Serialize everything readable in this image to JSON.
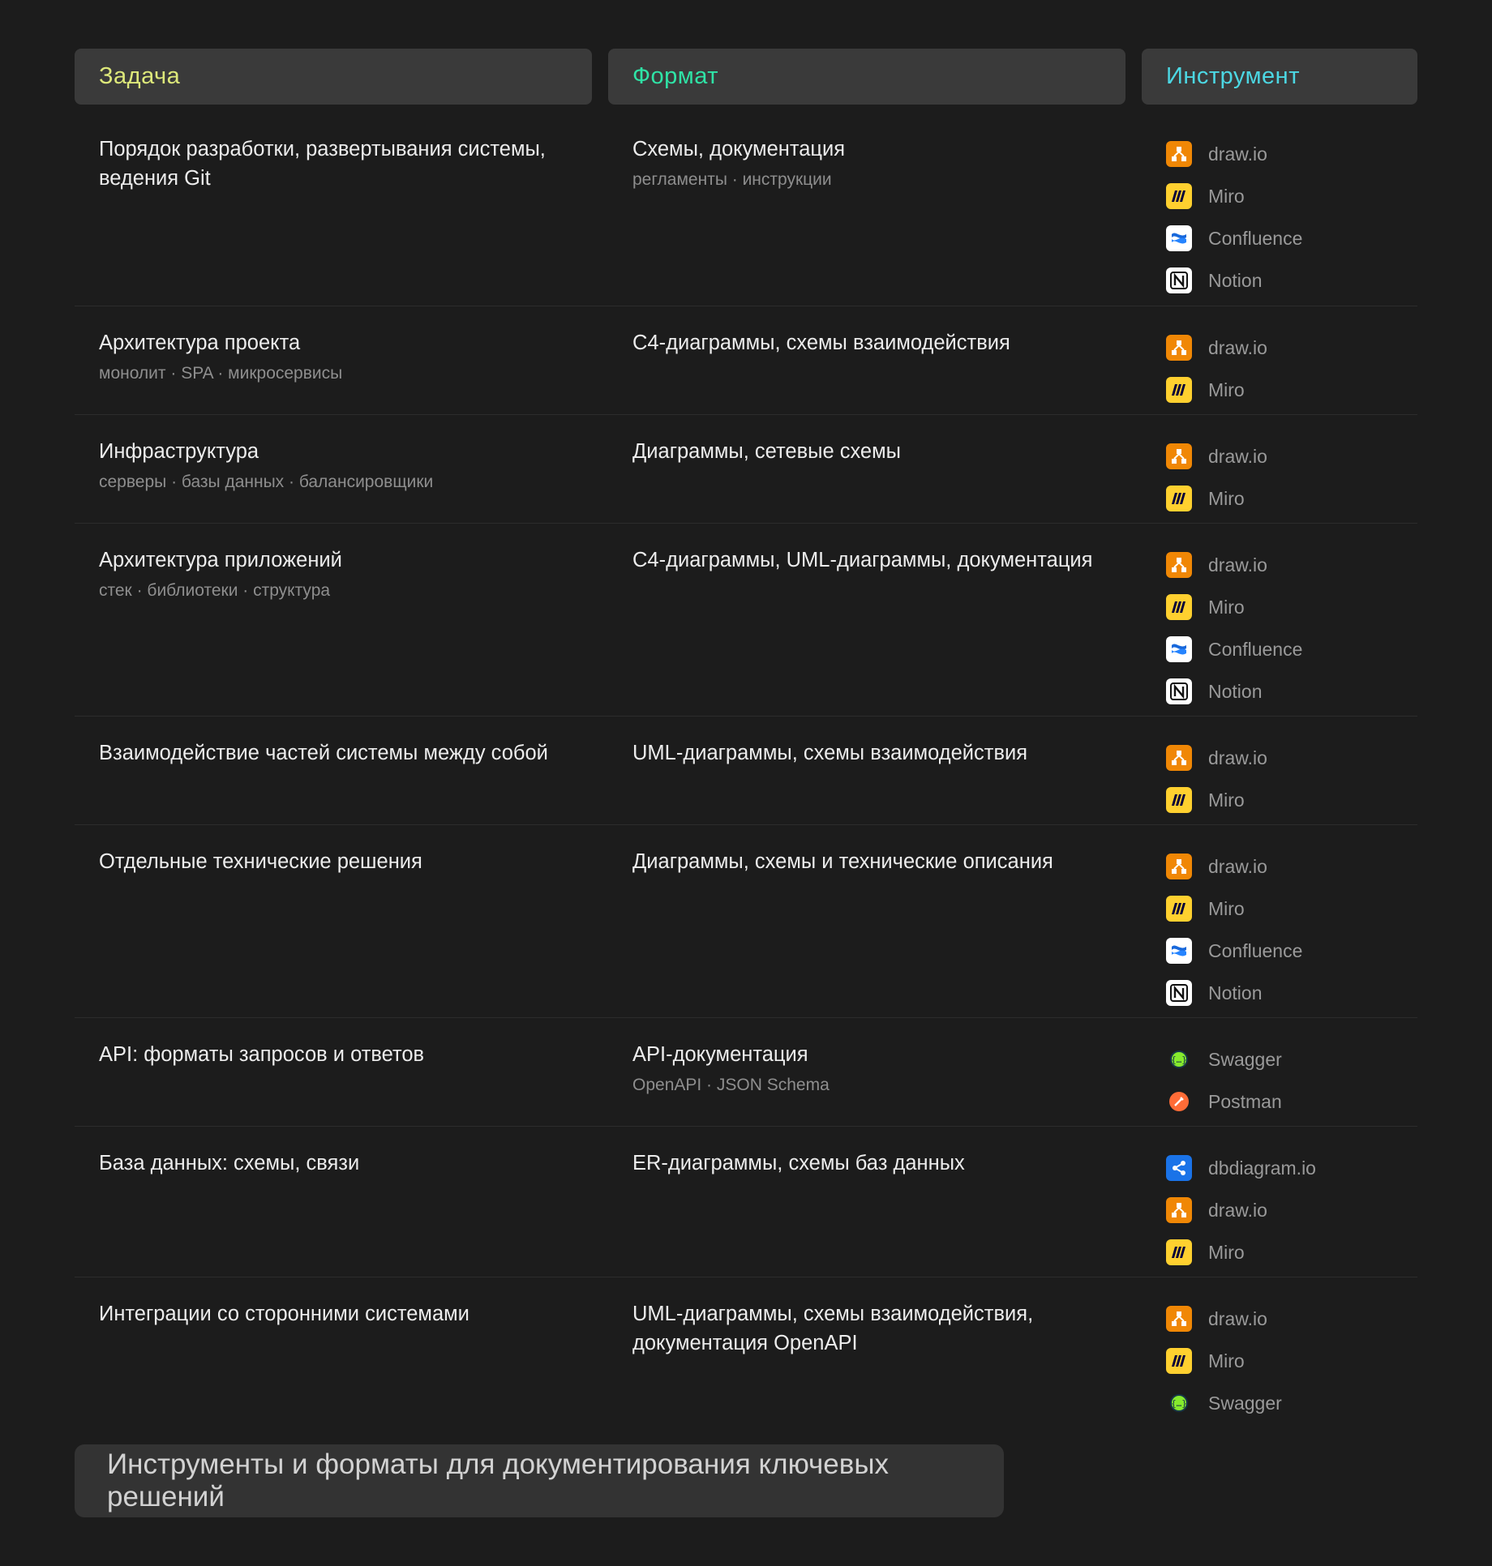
{
  "header": {
    "col_task": "Задача",
    "col_format": "Формат",
    "col_tool": "Инструмент",
    "colors": {
      "task": "#dde87a",
      "format": "#2fe3a6",
      "tool": "#4cd7e3"
    }
  },
  "tool_styles": {
    "drawio": {
      "icon": "drawio-icon",
      "bg": "#f08705"
    },
    "miro": {
      "icon": "miro-icon",
      "bg": "#ffd02f"
    },
    "confluence": {
      "icon": "confluence-icon",
      "bg": "#ffffff"
    },
    "notion": {
      "icon": "notion-icon",
      "bg": "#ffffff"
    },
    "swagger": {
      "icon": "swagger-icon",
      "bg": "#85ea2d"
    },
    "postman": {
      "icon": "postman-icon",
      "bg": "#ff6c37"
    },
    "dbdiagram": {
      "icon": "dbdiagram-icon",
      "bg": "#1a73e8"
    }
  },
  "rows": [
    {
      "task": "Порядок разработки, развертывания системы, ведения Git",
      "task_sub": "",
      "format": "Схемы, документация",
      "format_sub": "регламенты · инструкции",
      "tools": [
        {
          "key": "drawio",
          "label": "draw.io"
        },
        {
          "key": "miro",
          "label": "Miro"
        },
        {
          "key": "confluence",
          "label": "Confluence"
        },
        {
          "key": "notion",
          "label": "Notion"
        }
      ]
    },
    {
      "task": "Архитектура проекта",
      "task_sub": "монолит · SPA · микросервисы",
      "format": "C4-диаграммы, схемы взаимодействия",
      "format_sub": "",
      "tools": [
        {
          "key": "drawio",
          "label": "draw.io"
        },
        {
          "key": "miro",
          "label": "Miro"
        }
      ]
    },
    {
      "task": "Инфраструктура",
      "task_sub": "серверы · базы данных · балансировщики",
      "format": "Диаграммы, сетевые схемы",
      "format_sub": "",
      "tools": [
        {
          "key": "drawio",
          "label": "draw.io"
        },
        {
          "key": "miro",
          "label": "Miro"
        }
      ]
    },
    {
      "task": "Архитектура приложений",
      "task_sub": "стек · библиотеки · структура",
      "format": "C4-диаграммы, UML-диаграммы, документация",
      "format_sub": "",
      "tools": [
        {
          "key": "drawio",
          "label": "draw.io"
        },
        {
          "key": "miro",
          "label": "Miro"
        },
        {
          "key": "confluence",
          "label": "Confluence"
        },
        {
          "key": "notion",
          "label": "Notion"
        }
      ]
    },
    {
      "task": "Взаимодействие частей системы между собой",
      "task_sub": "",
      "format": "UML-диаграммы, схемы взаимодействия",
      "format_sub": "",
      "tools": [
        {
          "key": "drawio",
          "label": "draw.io"
        },
        {
          "key": "miro",
          "label": "Miro"
        }
      ]
    },
    {
      "task": "Отдельные технические решения",
      "task_sub": "",
      "format": "Диаграммы, схемы и технические описания",
      "format_sub": "",
      "tools": [
        {
          "key": "drawio",
          "label": "draw.io"
        },
        {
          "key": "miro",
          "label": "Miro"
        },
        {
          "key": "confluence",
          "label": "Confluence"
        },
        {
          "key": "notion",
          "label": "Notion"
        }
      ]
    },
    {
      "task": "API: форматы запросов и ответов",
      "task_sub": "",
      "format": "API-документация",
      "format_sub": "OpenAPI · JSON Schema",
      "tools": [
        {
          "key": "swagger",
          "label": "Swagger"
        },
        {
          "key": "postman",
          "label": "Postman"
        }
      ]
    },
    {
      "task": "База данных: схемы, связи",
      "task_sub": "",
      "format": "ER-диаграммы, схемы баз данных",
      "format_sub": "",
      "tools": [
        {
          "key": "dbdiagram",
          "label": "dbdiagram.io"
        },
        {
          "key": "drawio",
          "label": "draw.io"
        },
        {
          "key": "miro",
          "label": "Miro"
        }
      ]
    },
    {
      "task": "Интеграции со сторонними системами",
      "task_sub": "",
      "format": "UML-диаграммы, схемы взаимодействия, документация OpenAPI",
      "format_sub": "",
      "tools": [
        {
          "key": "drawio",
          "label": "draw.io"
        },
        {
          "key": "miro",
          "label": "Miro"
        },
        {
          "key": "swagger",
          "label": "Swagger"
        }
      ]
    }
  ],
  "caption": "Инструменты и форматы для документирования ключевых решений"
}
